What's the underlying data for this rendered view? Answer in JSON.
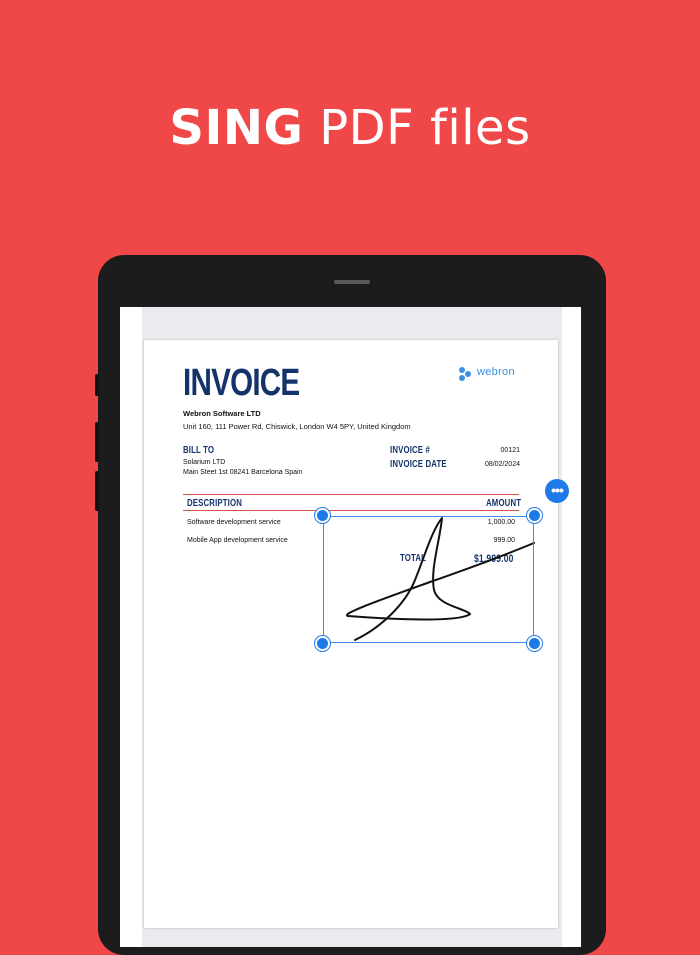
{
  "headline": {
    "bold": "SING",
    "light": "PDF files"
  },
  "invoice": {
    "title": "INVOICE",
    "logo_text": "webron",
    "company": "Webron Software LTD",
    "address": "Unit 160, 111 Power Rd, Chiswick, London W4 5PY, United Kingdom",
    "bill_to_label": "BILL TO",
    "bill_to_name": "Solarium LTD",
    "bill_to_address": "Main Steet 1st 08241 Barcelona Spain",
    "invoice_no_label": "INVOICE #",
    "invoice_no": "00121",
    "invoice_date_label": "INVOICE DATE",
    "invoice_date": "08/02/2024",
    "description_header": "DESCRIPTION",
    "amount_header": "AMOUNT",
    "items": [
      {
        "description": "Software development service",
        "amount": "1,000.00"
      },
      {
        "description": "Mobile App development service",
        "amount": "999.00"
      }
    ],
    "total_label": "TOTAL",
    "total_value": "$1,999.00"
  },
  "signature_menu": {
    "label": "•••"
  },
  "colors": {
    "background": "#f04848",
    "accent": "#1f7ae8",
    "invoice_blue": "#14336b",
    "rule_red": "#d9534f"
  }
}
